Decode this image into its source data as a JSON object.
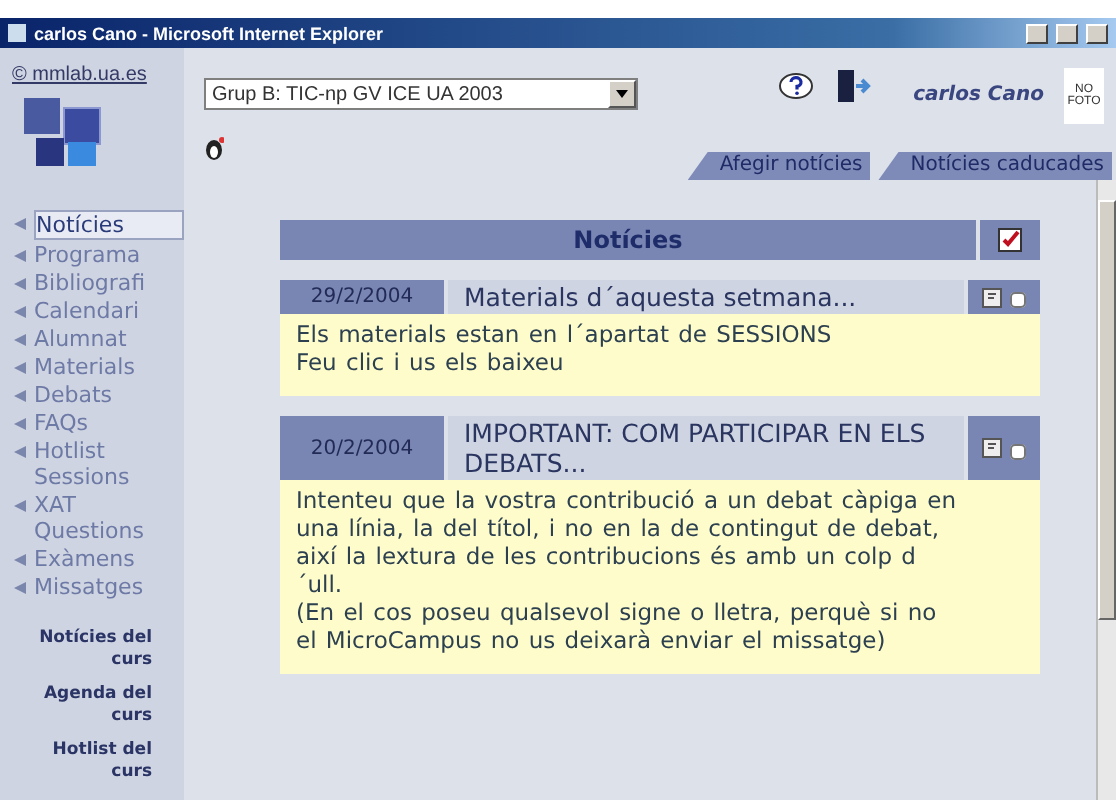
{
  "window": {
    "title": "carlos Cano - Microsoft Internet Explorer"
  },
  "header": {
    "copyright": "© mmlab.ua.es",
    "group_select": {
      "value": "Grup B: TIC-np GV ICE UA 2003"
    },
    "user_name": "carlos Cano",
    "photo_text": "NO FOTO"
  },
  "tabs": [
    {
      "label": "Afegir notícies",
      "selected": false
    },
    {
      "label": "Notícies caducades",
      "selected": false
    }
  ],
  "sidebar": {
    "items": [
      {
        "label": "Notícies",
        "selected": true
      },
      {
        "label": "Programa",
        "selected": false
      },
      {
        "label": "Bibliografi",
        "selected": false
      },
      {
        "label": "Calendari",
        "selected": false
      },
      {
        "label": "Alumnat",
        "selected": false
      },
      {
        "label": "Materials",
        "selected": false
      },
      {
        "label": "Debats",
        "selected": false
      },
      {
        "label": "FAQs",
        "selected": false
      },
      {
        "label": "Hotlist Sessions",
        "selected": false
      },
      {
        "label": "XAT Questions",
        "selected": false
      },
      {
        "label": "Exàmens",
        "selected": false
      },
      {
        "label": "Missatges",
        "selected": false
      }
    ],
    "links": [
      "Notícies del curs",
      "Agenda del curs",
      "Hotlist del curs"
    ]
  },
  "panel": {
    "title": "Notícies",
    "news": [
      {
        "date": "29/2/2004",
        "title": "Materials d´aquesta setmana...",
        "body": "Els materials estan en l´apartat de SESSIONS\nFeu clic i us els baixeu",
        "checked": false
      },
      {
        "date": "20/2/2004",
        "title": "IMPORTANT: COM PARTICIPAR EN ELS DEBATS...",
        "body": "Intenteu que la vostra contribució a un debat càpiga en una línia, la del títol, i no en la de contingut de debat, així la lextura de les contribucions és amb un colp d´ull.\n(En el cos poseu qualsevol signe o lletra, perquè si no el MicroCampus no us deixarà enviar el missatge)",
        "checked": false
      }
    ]
  }
}
